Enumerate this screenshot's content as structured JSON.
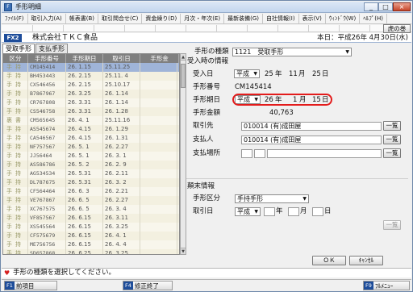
{
  "window": {
    "title": "手形明細",
    "minimize": "_",
    "maximize": "□",
    "close": "×",
    "toranomaki": "虎の巻"
  },
  "menu": [
    "ﾌｧｲﾙ(F)",
    "取引入力(A)",
    "帳表書(B)",
    "取引問合せ(C)",
    "資金繰り(D)",
    "月次・年次(E)",
    "最新装備(G)",
    "自社情報(I)",
    "表示(V)",
    "ｳｨﾝﾄﾞｳ(W)",
    "ﾍﾙﾌﾟ(H)"
  ],
  "header": {
    "fx2": "FX2",
    "company": "株式会社ＴＫＣ食品",
    "today": "本日：平成26年 4月30日(水)"
  },
  "tabs": [
    "受取手形",
    "支払手形"
  ],
  "grid": {
    "columns": [
      "区分",
      "手形番号",
      "手形期日",
      "取引日",
      "手形金"
    ],
    "rows": [
      [
        "手持",
        "CM145414",
        "26. 1.15",
        "25.11.25",
        ""
      ],
      [
        "手持",
        "BH453443",
        "26. 2.15",
        "25.11. 4",
        ""
      ],
      [
        "手持",
        "CX546456",
        "26. 2.15",
        "25.10.17",
        ""
      ],
      [
        "手持",
        "B7867967",
        "26. 3.25",
        "26. 1.14",
        ""
      ],
      [
        "手持",
        "CR767808",
        "26. 3.31",
        "26. 1.14",
        ""
      ],
      [
        "手持",
        "CS546758",
        "26. 3.31",
        "26. 1.28",
        ""
      ],
      [
        "裏書",
        "CM565645",
        "26. 4. 1",
        "25.11.16",
        ""
      ],
      [
        "手持",
        "AS545674",
        "26. 4.15",
        "26. 1.29",
        ""
      ],
      [
        "手持",
        "CA546567",
        "26. 4.15",
        "26. 1.31",
        ""
      ],
      [
        "手持",
        "NF757567",
        "26. 5. 1",
        "26. 2.27",
        ""
      ],
      [
        "手持",
        "JJ56464",
        "26. 5. 1",
        "26. 3. 1",
        ""
      ],
      [
        "手持",
        "AS586786",
        "26. 5. 2",
        "26. 2. 9",
        ""
      ],
      [
        "手持",
        "AG534534",
        "26. 5.31",
        "26. 2.11",
        ""
      ],
      [
        "手持",
        "DL787675",
        "26. 5.31",
        "26. 3. 2",
        ""
      ],
      [
        "手持",
        "CF564464",
        "26. 6. 3",
        "26. 2.21",
        ""
      ],
      [
        "手持",
        "VE767867",
        "26. 6. 5",
        "26. 2.27",
        ""
      ],
      [
        "手持",
        "XC767575",
        "26. 6. 5",
        "26. 3. 4",
        ""
      ],
      [
        "手持",
        "VF857567",
        "26. 6.15",
        "26. 3.11",
        ""
      ],
      [
        "手持",
        "XS545564",
        "26. 6.15",
        "26. 3.25",
        ""
      ],
      [
        "手持",
        "CF575679",
        "26. 6.15",
        "26. 4. 1",
        ""
      ],
      [
        "手持",
        "ME756756",
        "26. 6.15",
        "26. 4. 4",
        ""
      ],
      [
        "手持",
        "SD657868",
        "26. 6.25",
        "26. 3.25",
        ""
      ]
    ]
  },
  "form": {
    "type_label": "手形の種類",
    "type_value": "1121　受取手形",
    "section_receive": "受入時の情報",
    "receive_date_label": "受入日",
    "receive_era": "平成",
    "receive_year": "25",
    "receive_month": "11",
    "receive_day": "25",
    "note_no_label": "手形番号",
    "note_no": "CM145414",
    "due_label": "手形期日",
    "due_era": "平成",
    "due_year": "26",
    "due_month": "1",
    "due_day": "15",
    "amount_label": "手形金額",
    "amount": "40,763",
    "client_label": "取引先",
    "client": "010014 (有)成田屋",
    "payer_label": "支払人",
    "payer": "010014 (有)成田屋",
    "place_label": "支払場所",
    "place": "",
    "list_btn": "一覧",
    "unit_year": "年",
    "unit_month": "月",
    "unit_day": "日",
    "section_end": "顛末情報",
    "end_kind_label": "手形区分",
    "end_kind": "手持手形",
    "trade_date_label": "取引日",
    "trade_era": "平成",
    "ok": "ＯＫ",
    "cancel": "ｷｬﾝｾﾙ"
  },
  "status": {
    "message": "手形の種類を選択してください。"
  },
  "fkeys": [
    {
      "key": "F1",
      "label": "前項目"
    },
    {
      "key": "F4",
      "label": "修正終了"
    },
    {
      "key": "F9",
      "label": "ﾌﾙﾒﾆｭｰ"
    }
  ],
  "colors": {
    "accent": "#1e4d9a",
    "highlight": "#e31b1b",
    "selected_row": "#9fb4d8"
  }
}
